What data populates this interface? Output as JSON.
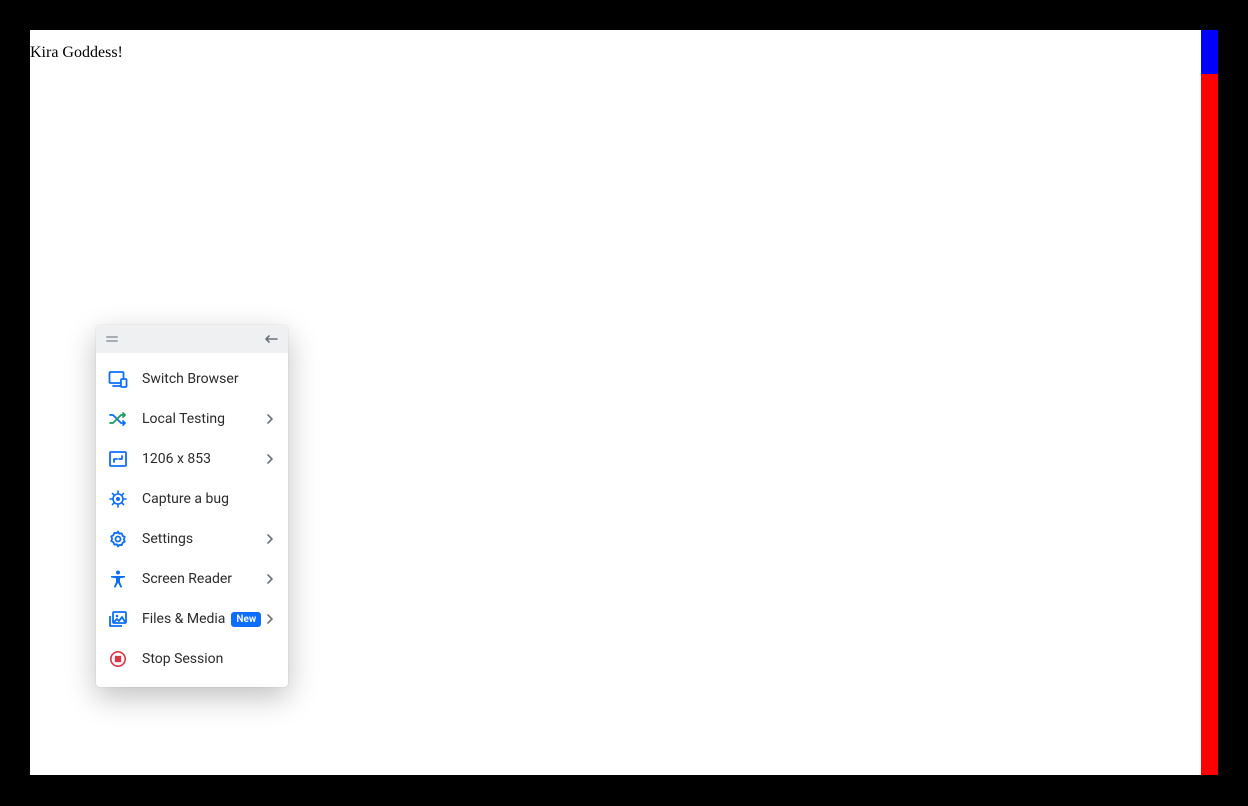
{
  "page": {
    "title": "Kira Goddess!"
  },
  "panel": {
    "items": [
      {
        "label": "Switch Browser",
        "icon": "browser",
        "chevron": false
      },
      {
        "label": "Local Testing",
        "icon": "shuffle",
        "chevron": true
      },
      {
        "label": "1206 x 853",
        "icon": "resize",
        "chevron": true
      },
      {
        "label": "Capture a bug",
        "icon": "bug",
        "chevron": false
      },
      {
        "label": "Settings",
        "icon": "gear",
        "chevron": true
      },
      {
        "label": "Screen Reader",
        "icon": "accessibility",
        "chevron": true
      },
      {
        "label": "Files & Media",
        "icon": "media",
        "chevron": true,
        "badge": "New"
      },
      {
        "label": "Stop Session",
        "icon": "stop",
        "chevron": false
      }
    ]
  },
  "colors": {
    "accent": "#0d6efd",
    "danger": "#dc3545",
    "green": "#1a9e5a"
  }
}
